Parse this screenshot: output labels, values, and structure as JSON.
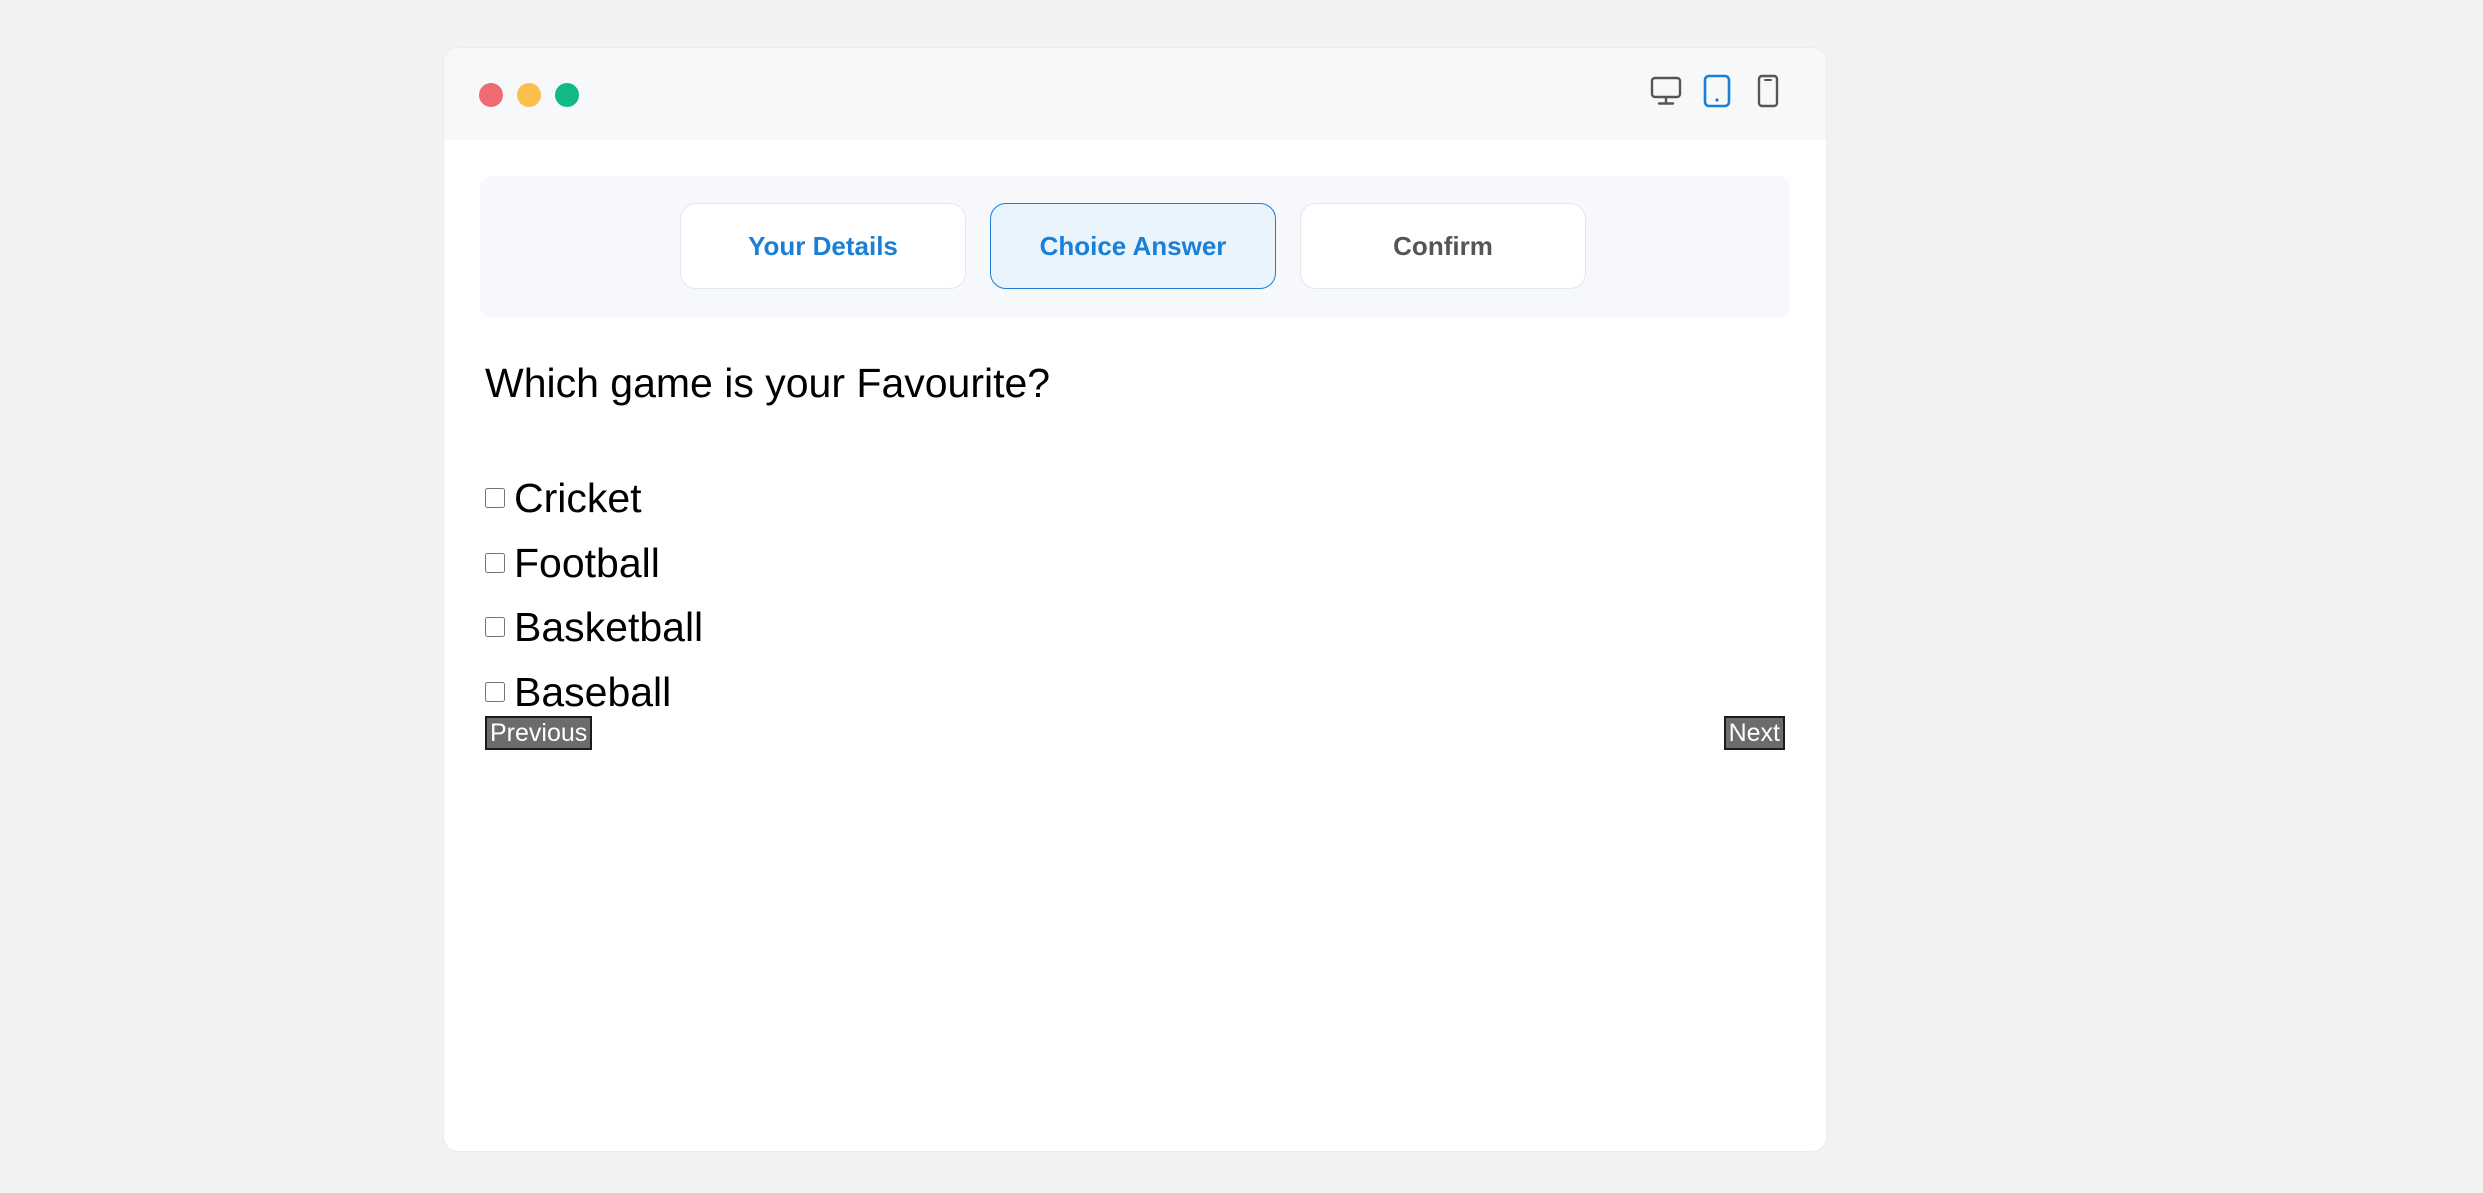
{
  "window_controls": {
    "close_color": "#ef6b73",
    "minimize_color": "#fbc04b",
    "maximize_color": "#12b886"
  },
  "device_toolbar": {
    "icons": [
      "desktop-icon",
      "tablet-icon",
      "mobile-icon"
    ],
    "active": "tablet",
    "active_color": "#1a7fd6",
    "inactive_color": "#555555"
  },
  "steps": [
    {
      "label": "Your Details",
      "state": "done",
      "color": "#1a7fd6"
    },
    {
      "label": "Choice Answer",
      "state": "active",
      "color": "#1a7fd6"
    },
    {
      "label": "Confirm",
      "state": "pending",
      "color": "#555555"
    }
  ],
  "quiz": {
    "question": "Which game is your Favourite?",
    "options": [
      {
        "label": "Cricket",
        "checked": false
      },
      {
        "label": "Football",
        "checked": false
      },
      {
        "label": "Basketball",
        "checked": false
      },
      {
        "label": "Baseball",
        "checked": false
      }
    ]
  },
  "nav": {
    "previous_label": "Previous",
    "next_label": "Next"
  }
}
